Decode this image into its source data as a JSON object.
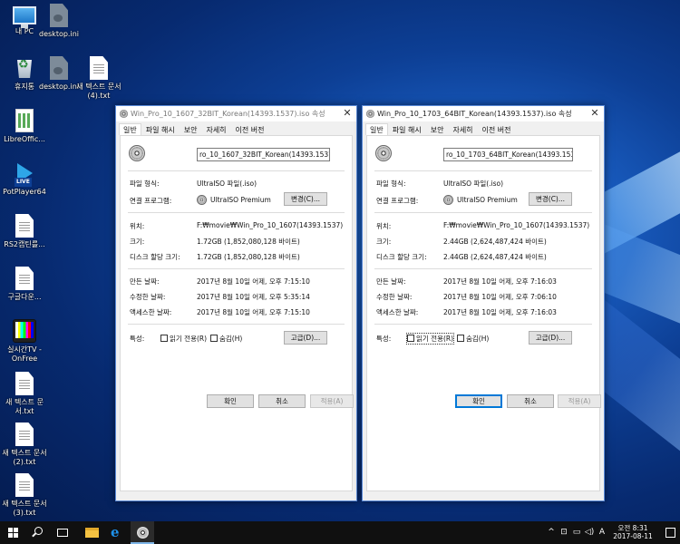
{
  "desktop": {
    "icons": [
      {
        "label": "내 PC",
        "icon": "computer-icon"
      },
      {
        "label": "desktop.ini",
        "icon": "ini-file-icon"
      },
      {
        "label": "휴지통",
        "icon": "recycle-bin-icon"
      },
      {
        "label": "desktop.ini",
        "icon": "ini-file-icon"
      },
      {
        "label": "새 텍스트 문서 (4).txt",
        "icon": "text-file-icon"
      },
      {
        "label": "LibreOffic...",
        "icon": "libreoffice-calc-icon"
      },
      {
        "label": "PotPlayer64",
        "icon": "potplayer-icon"
      },
      {
        "label": "RS2캡틴를...",
        "icon": "text-file-icon"
      },
      {
        "label": "구글다운...",
        "icon": "text-file-icon"
      },
      {
        "label": "실시간TV - OnFree",
        "icon": "tv-icon"
      },
      {
        "label": "새 텍스트 문서.txt",
        "icon": "text-file-icon"
      },
      {
        "label": "새 텍스트 문서 (2).txt",
        "icon": "text-file-icon"
      },
      {
        "label": "새 텍스트 문서 (3).txt",
        "icon": "text-file-icon"
      }
    ]
  },
  "windows": [
    {
      "title": "Win_Pro_10_1607_32BIT_Korean(14393.1537).iso 속성",
      "tabs": [
        "일반",
        "파일 해시",
        "보안",
        "자세히",
        "이전 버전"
      ],
      "active_tab": "일반",
      "filename": "ro_10_1607_32BIT_Korean(14393.1537).iso",
      "labels": {
        "type": "파일 형식:",
        "open_with": "연결 프로그램:",
        "location": "위치:",
        "size": "크기:",
        "size_on_disk": "디스크 할당 크기:",
        "created": "만든 날짜:",
        "modified": "수정한 날짜:",
        "accessed": "액세스한 날짜:",
        "attributes": "특성:"
      },
      "values": {
        "type": "UltraISO 파일(.iso)",
        "open_with": "UltraISO Premium",
        "location": "F:₩movie₩Win_Pro_10_1607(14393.1537)",
        "size": "1.72GB (1,852,080,128 바이트)",
        "size_on_disk": "1.72GB (1,852,080,128 바이트)",
        "created": "2017년 8월 10일 어제, 오후 7:15:10",
        "modified": "2017년 8월 10일 어제, 오후 5:35:14",
        "accessed": "2017년 8월 10일 어제, 오후 7:15:10"
      },
      "change_button": "변경(C)...",
      "readonly_label": "읽기 전용(R)",
      "hidden_label": "숨김(H)",
      "advanced_button": "고급(D)...",
      "ok_button": "확인",
      "cancel_button": "취소",
      "apply_button": "적용(A)"
    },
    {
      "title": "Win_Pro_10_1703_64BIT_Korean(14393.1537).iso 속성",
      "tabs": [
        "일반",
        "파일 해시",
        "보안",
        "자세히",
        "이전 버전"
      ],
      "active_tab": "일반",
      "filename": "ro_10_1703_64BIT_Korean(14393.1537).iso",
      "labels": {
        "type": "파일 형식:",
        "open_with": "연결 프로그램:",
        "location": "위치:",
        "size": "크기:",
        "size_on_disk": "디스크 할당 크기:",
        "created": "만든 날짜:",
        "modified": "수정한 날짜:",
        "accessed": "액세스한 날짜:",
        "attributes": "특성:"
      },
      "values": {
        "type": "UltraISO 파일(.iso)",
        "open_with": "UltraISO Premium",
        "location": "F:₩movie₩Win_Pro_10_1607(14393.1537)",
        "size": "2.44GB (2,624,487,424 바이트)",
        "size_on_disk": "2.44GB (2,624,487,424 바이트)",
        "created": "2017년 8월 10일 어제, 오후 7:16:03",
        "modified": "2017년 8월 10일 어제, 오후 7:06:10",
        "accessed": "2017년 8월 10일 어제, 오후 7:16:03"
      },
      "change_button": "변경(C)...",
      "readonly_label": "읽기 전용(R)",
      "hidden_label": "숨김(H)",
      "advanced_button": "고급(D)...",
      "ok_button": "확인",
      "cancel_button": "취소",
      "apply_button": "적용(A)"
    }
  ],
  "taskbar": {
    "tray_chevron": "^",
    "ime": "A",
    "clock_time": "오전 8:31",
    "clock_date": "2017-08-11"
  }
}
